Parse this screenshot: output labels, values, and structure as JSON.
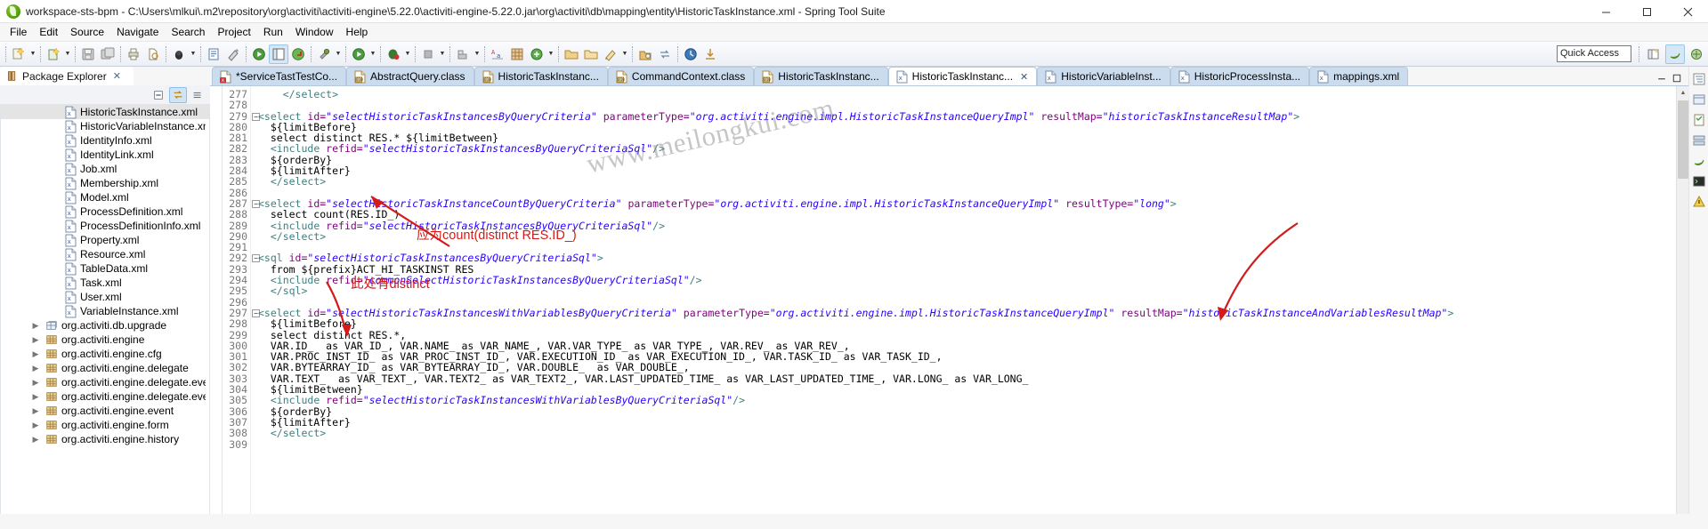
{
  "window": {
    "title": "workspace-sts-bpm - C:\\Users\\mlkui\\.m2\\repository\\org\\activiti\\activiti-engine\\5.22.0\\activiti-engine-5.22.0.jar\\org\\activiti\\db\\mapping\\entity\\HistoricTaskInstance.xml - Spring Tool Suite",
    "controls": {
      "minimize": "minimize-icon",
      "maximize": "maximize-icon",
      "close": "close-icon"
    }
  },
  "menu": {
    "items": [
      "File",
      "Edit",
      "Source",
      "Navigate",
      "Search",
      "Project",
      "Run",
      "Window",
      "Help"
    ]
  },
  "toolbar": {
    "quick_access_label": "Quick Access"
  },
  "explorer": {
    "view_title": "Package Explorer",
    "close_label": "✕",
    "buttons": [
      "collapse-all-icon",
      "link-with-editor-icon",
      "view-menu-icon"
    ],
    "tree": [
      {
        "label": "HistoricTaskInstance.xml",
        "icon": "xml-file-icon",
        "indent": 2,
        "twisty": "",
        "selected": true
      },
      {
        "label": "HistoricVariableInstance.xml",
        "icon": "xml-file-icon",
        "indent": 2,
        "twisty": "",
        "selected": false
      },
      {
        "label": "IdentityInfo.xml",
        "icon": "xml-file-icon",
        "indent": 2,
        "twisty": "",
        "selected": false
      },
      {
        "label": "IdentityLink.xml",
        "icon": "xml-file-icon",
        "indent": 2,
        "twisty": "",
        "selected": false
      },
      {
        "label": "Job.xml",
        "icon": "xml-file-icon",
        "indent": 2,
        "twisty": "",
        "selected": false
      },
      {
        "label": "Membership.xml",
        "icon": "xml-file-icon",
        "indent": 2,
        "twisty": "",
        "selected": false
      },
      {
        "label": "Model.xml",
        "icon": "xml-file-icon",
        "indent": 2,
        "twisty": "",
        "selected": false
      },
      {
        "label": "ProcessDefinition.xml",
        "icon": "xml-file-icon",
        "indent": 2,
        "twisty": "",
        "selected": false
      },
      {
        "label": "ProcessDefinitionInfo.xml",
        "icon": "xml-file-icon",
        "indent": 2,
        "twisty": "",
        "selected": false
      },
      {
        "label": "Property.xml",
        "icon": "xml-file-icon",
        "indent": 2,
        "twisty": "",
        "selected": false
      },
      {
        "label": "Resource.xml",
        "icon": "xml-file-icon",
        "indent": 2,
        "twisty": "",
        "selected": false
      },
      {
        "label": "TableData.xml",
        "icon": "xml-file-icon",
        "indent": 2,
        "twisty": "",
        "selected": false
      },
      {
        "label": "Task.xml",
        "icon": "xml-file-icon",
        "indent": 2,
        "twisty": "",
        "selected": false
      },
      {
        "label": "User.xml",
        "icon": "xml-file-icon",
        "indent": 2,
        "twisty": "",
        "selected": false
      },
      {
        "label": "VariableInstance.xml",
        "icon": "xml-file-icon",
        "indent": 2,
        "twisty": "",
        "selected": false
      },
      {
        "label": "org.activiti.db.upgrade",
        "icon": "package-db-icon",
        "indent": 1,
        "twisty": "▶",
        "selected": false
      },
      {
        "label": "org.activiti.engine",
        "icon": "package-icon",
        "indent": 1,
        "twisty": "▶",
        "selected": false
      },
      {
        "label": "org.activiti.engine.cfg",
        "icon": "package-icon",
        "indent": 1,
        "twisty": "▶",
        "selected": false
      },
      {
        "label": "org.activiti.engine.delegate",
        "icon": "package-icon",
        "indent": 1,
        "twisty": "▶",
        "selected": false
      },
      {
        "label": "org.activiti.engine.delegate.eve",
        "icon": "package-icon",
        "indent": 1,
        "twisty": "▶",
        "selected": false
      },
      {
        "label": "org.activiti.engine.delegate.eve",
        "icon": "package-icon",
        "indent": 1,
        "twisty": "▶",
        "selected": false
      },
      {
        "label": "org.activiti.engine.event",
        "icon": "package-icon",
        "indent": 1,
        "twisty": "▶",
        "selected": false
      },
      {
        "label": "org.activiti.engine.form",
        "icon": "package-icon",
        "indent": 1,
        "twisty": "▶",
        "selected": false
      },
      {
        "label": "org.activiti.engine.history",
        "icon": "package-icon",
        "indent": 1,
        "twisty": "▶",
        "selected": false
      }
    ]
  },
  "editor_tabs": [
    {
      "label": "*ServiceTastTestCo...",
      "icon": "java-error-file-icon",
      "active": false,
      "dirty": true,
      "closable": false
    },
    {
      "label": "AbstractQuery.class",
      "icon": "class-file-icon",
      "active": false,
      "dirty": false,
      "closable": false
    },
    {
      "label": "HistoricTaskInstanc...",
      "icon": "class-file-icon",
      "active": false,
      "dirty": false,
      "closable": false
    },
    {
      "label": "CommandContext.class",
      "icon": "class-file-icon",
      "active": false,
      "dirty": false,
      "closable": false
    },
    {
      "label": "HistoricTaskInstanc...",
      "icon": "class-file-icon",
      "active": false,
      "dirty": false,
      "closable": false
    },
    {
      "label": "HistoricTaskInstanc...",
      "icon": "xml-file-icon",
      "active": true,
      "dirty": false,
      "closable": true
    },
    {
      "label": "HistoricVariableInst...",
      "icon": "xml-file-icon",
      "active": false,
      "dirty": false,
      "closable": false
    },
    {
      "label": "HistoricProcessInsta...",
      "icon": "xml-file-icon",
      "active": false,
      "dirty": false,
      "closable": false
    },
    {
      "label": "mappings.xml",
      "icon": "xml-file-icon",
      "active": false,
      "dirty": false,
      "closable": false
    }
  ],
  "code": {
    "first_line": 277,
    "lines": [
      {
        "n": 277,
        "fold": false,
        "tokens": [
          {
            "t": "    ",
            "c": "p"
          },
          {
            "t": "</select>",
            "c": "k"
          }
        ]
      },
      {
        "n": 278,
        "fold": false,
        "tokens": []
      },
      {
        "n": 279,
        "fold": true,
        "tokens": [
          {
            "t": "<select ",
            "c": "k"
          },
          {
            "t": "id=",
            "c": "a"
          },
          {
            "t": "\"selectHistoricTaskInstancesByQueryCriteria\"",
            "c": "v"
          },
          {
            "t": " ",
            "c": "p"
          },
          {
            "t": "parameterType=",
            "c": "a"
          },
          {
            "t": "\"org.activiti.engine.impl.HistoricTaskInstanceQueryImpl\"",
            "c": "v"
          },
          {
            "t": " ",
            "c": "p"
          },
          {
            "t": "resultMap=",
            "c": "a"
          },
          {
            "t": "\"historicTaskInstanceResultMap\"",
            "c": "v"
          },
          {
            "t": ">",
            "c": "k"
          }
        ]
      },
      {
        "n": 280,
        "fold": false,
        "tokens": [
          {
            "t": "  ${limitBefore}",
            "c": "p"
          }
        ]
      },
      {
        "n": 281,
        "fold": false,
        "tokens": [
          {
            "t": "  select distinct RES.* ${limitBetween}",
            "c": "p"
          }
        ]
      },
      {
        "n": 282,
        "fold": false,
        "tokens": [
          {
            "t": "  ",
            "c": "p"
          },
          {
            "t": "<include ",
            "c": "k"
          },
          {
            "t": "refid=",
            "c": "a"
          },
          {
            "t": "\"selectHistoricTaskInstancesByQueryCriteriaSql\"",
            "c": "v"
          },
          {
            "t": "/>",
            "c": "k"
          }
        ]
      },
      {
        "n": 283,
        "fold": false,
        "tokens": [
          {
            "t": "  ${orderBy}",
            "c": "p"
          }
        ]
      },
      {
        "n": 284,
        "fold": false,
        "tokens": [
          {
            "t": "  ${limitAfter}",
            "c": "p"
          }
        ]
      },
      {
        "n": 285,
        "fold": false,
        "tokens": [
          {
            "t": "  ",
            "c": "p"
          },
          {
            "t": "</select>",
            "c": "k"
          }
        ]
      },
      {
        "n": 286,
        "fold": false,
        "tokens": []
      },
      {
        "n": 287,
        "fold": true,
        "tokens": [
          {
            "t": "<select ",
            "c": "k"
          },
          {
            "t": "id=",
            "c": "a"
          },
          {
            "t": "\"selectHistoricTaskInstanceCountByQueryCriteria\"",
            "c": "v"
          },
          {
            "t": " ",
            "c": "p"
          },
          {
            "t": "parameterType=",
            "c": "a"
          },
          {
            "t": "\"org.activiti.engine.impl.HistoricTaskInstanceQueryImpl\"",
            "c": "v"
          },
          {
            "t": " ",
            "c": "p"
          },
          {
            "t": "resultType=",
            "c": "a"
          },
          {
            "t": "\"long\"",
            "c": "v"
          },
          {
            "t": ">",
            "c": "k"
          }
        ]
      },
      {
        "n": 288,
        "fold": false,
        "tokens": [
          {
            "t": "  select count(RES.ID_)",
            "c": "p"
          }
        ]
      },
      {
        "n": 289,
        "fold": false,
        "tokens": [
          {
            "t": "  ",
            "c": "p"
          },
          {
            "t": "<include ",
            "c": "k"
          },
          {
            "t": "refid=",
            "c": "a"
          },
          {
            "t": "\"selectHistoricTaskInstancesByQueryCriteriaSql\"",
            "c": "v"
          },
          {
            "t": "/>",
            "c": "k"
          }
        ]
      },
      {
        "n": 290,
        "fold": false,
        "tokens": [
          {
            "t": "  ",
            "c": "p"
          },
          {
            "t": "</select>",
            "c": "k"
          }
        ]
      },
      {
        "n": 291,
        "fold": false,
        "tokens": []
      },
      {
        "n": 292,
        "fold": true,
        "tokens": [
          {
            "t": "<sql ",
            "c": "k"
          },
          {
            "t": "id=",
            "c": "a"
          },
          {
            "t": "\"selectHistoricTaskInstancesByQueryCriteriaSql\"",
            "c": "v"
          },
          {
            "t": ">",
            "c": "k"
          }
        ]
      },
      {
        "n": 293,
        "fold": false,
        "tokens": [
          {
            "t": "  from ${prefix}ACT_HI_TASKINST RES",
            "c": "p"
          }
        ]
      },
      {
        "n": 294,
        "fold": false,
        "tokens": [
          {
            "t": "  ",
            "c": "p"
          },
          {
            "t": "<include ",
            "c": "k"
          },
          {
            "t": "refid=",
            "c": "a"
          },
          {
            "t": "\"commonSelectHistoricTaskInstancesByQueryCriteriaSql\"",
            "c": "v"
          },
          {
            "t": "/>",
            "c": "k"
          }
        ]
      },
      {
        "n": 295,
        "fold": false,
        "tokens": [
          {
            "t": "  ",
            "c": "p"
          },
          {
            "t": "</sql>",
            "c": "k"
          }
        ]
      },
      {
        "n": 296,
        "fold": false,
        "tokens": []
      },
      {
        "n": 297,
        "fold": true,
        "tokens": [
          {
            "t": "<select ",
            "c": "k"
          },
          {
            "t": "id=",
            "c": "a"
          },
          {
            "t": "\"selectHistoricTaskInstancesWithVariablesByQueryCriteria\"",
            "c": "v"
          },
          {
            "t": " ",
            "c": "p"
          },
          {
            "t": "parameterType=",
            "c": "a"
          },
          {
            "t": "\"org.activiti.engine.impl.HistoricTaskInstanceQueryImpl\"",
            "c": "v"
          },
          {
            "t": " ",
            "c": "p"
          },
          {
            "t": "resultMap=",
            "c": "a"
          },
          {
            "t": "\"historicTaskInstanceAndVariablesResultMap\"",
            "c": "v"
          },
          {
            "t": ">",
            "c": "k"
          }
        ]
      },
      {
        "n": 298,
        "fold": false,
        "tokens": [
          {
            "t": "  ${limitBefore}",
            "c": "p"
          }
        ]
      },
      {
        "n": 299,
        "fold": false,
        "tokens": [
          {
            "t": "  select distinct RES.*,",
            "c": "p"
          }
        ]
      },
      {
        "n": 300,
        "fold": false,
        "tokens": [
          {
            "t": "  VAR.ID_  as VAR_ID_, VAR.NAME_ as VAR_NAME_, VAR.VAR_TYPE_ as VAR_TYPE_, VAR.REV_ as VAR_REV_,",
            "c": "p"
          }
        ]
      },
      {
        "n": 301,
        "fold": false,
        "tokens": [
          {
            "t": "  VAR.PROC_INST_ID_ as VAR_PROC_INST_ID_, VAR.EXECUTION_ID_ as VAR_EXECUTION_ID_, VAR.TASK_ID_ as VAR_TASK_ID_,",
            "c": "p"
          }
        ]
      },
      {
        "n": 302,
        "fold": false,
        "tokens": [
          {
            "t": "  VAR.BYTEARRAY_ID_ as VAR_BYTEARRAY_ID_, VAR.DOUBLE_  as VAR_DOUBLE_,",
            "c": "p"
          }
        ]
      },
      {
        "n": 303,
        "fold": false,
        "tokens": [
          {
            "t": "  VAR.TEXT_  as VAR_TEXT_, VAR.TEXT2_ as VAR_TEXT2_, VAR.LAST_UPDATED_TIME_ as VAR_LAST_UPDATED_TIME_, VAR.LONG_ as VAR_LONG_",
            "c": "p"
          }
        ]
      },
      {
        "n": 304,
        "fold": false,
        "tokens": [
          {
            "t": "  ${limitBetween}",
            "c": "p"
          }
        ]
      },
      {
        "n": 305,
        "fold": false,
        "tokens": [
          {
            "t": "  ",
            "c": "p"
          },
          {
            "t": "<include ",
            "c": "k"
          },
          {
            "t": "refid=",
            "c": "a"
          },
          {
            "t": "\"selectHistoricTaskInstancesWithVariablesByQueryCriteriaSql\"",
            "c": "v"
          },
          {
            "t": "/>",
            "c": "k"
          }
        ]
      },
      {
        "n": 306,
        "fold": false,
        "tokens": [
          {
            "t": "  ${orderBy}",
            "c": "p"
          }
        ]
      },
      {
        "n": 307,
        "fold": false,
        "tokens": [
          {
            "t": "  ${limitAfter}",
            "c": "p"
          }
        ]
      },
      {
        "n": 308,
        "fold": false,
        "tokens": [
          {
            "t": "  ",
            "c": "p"
          },
          {
            "t": "</select>",
            "c": "k"
          }
        ]
      },
      {
        "n": 309,
        "fold": false,
        "tokens": []
      }
    ]
  },
  "annotations": {
    "color": "#d21b1b",
    "note_1": "应为count(distinct RES.ID_)",
    "note_2": "此处有distinct",
    "watermark": "www.meilongkui.com"
  }
}
